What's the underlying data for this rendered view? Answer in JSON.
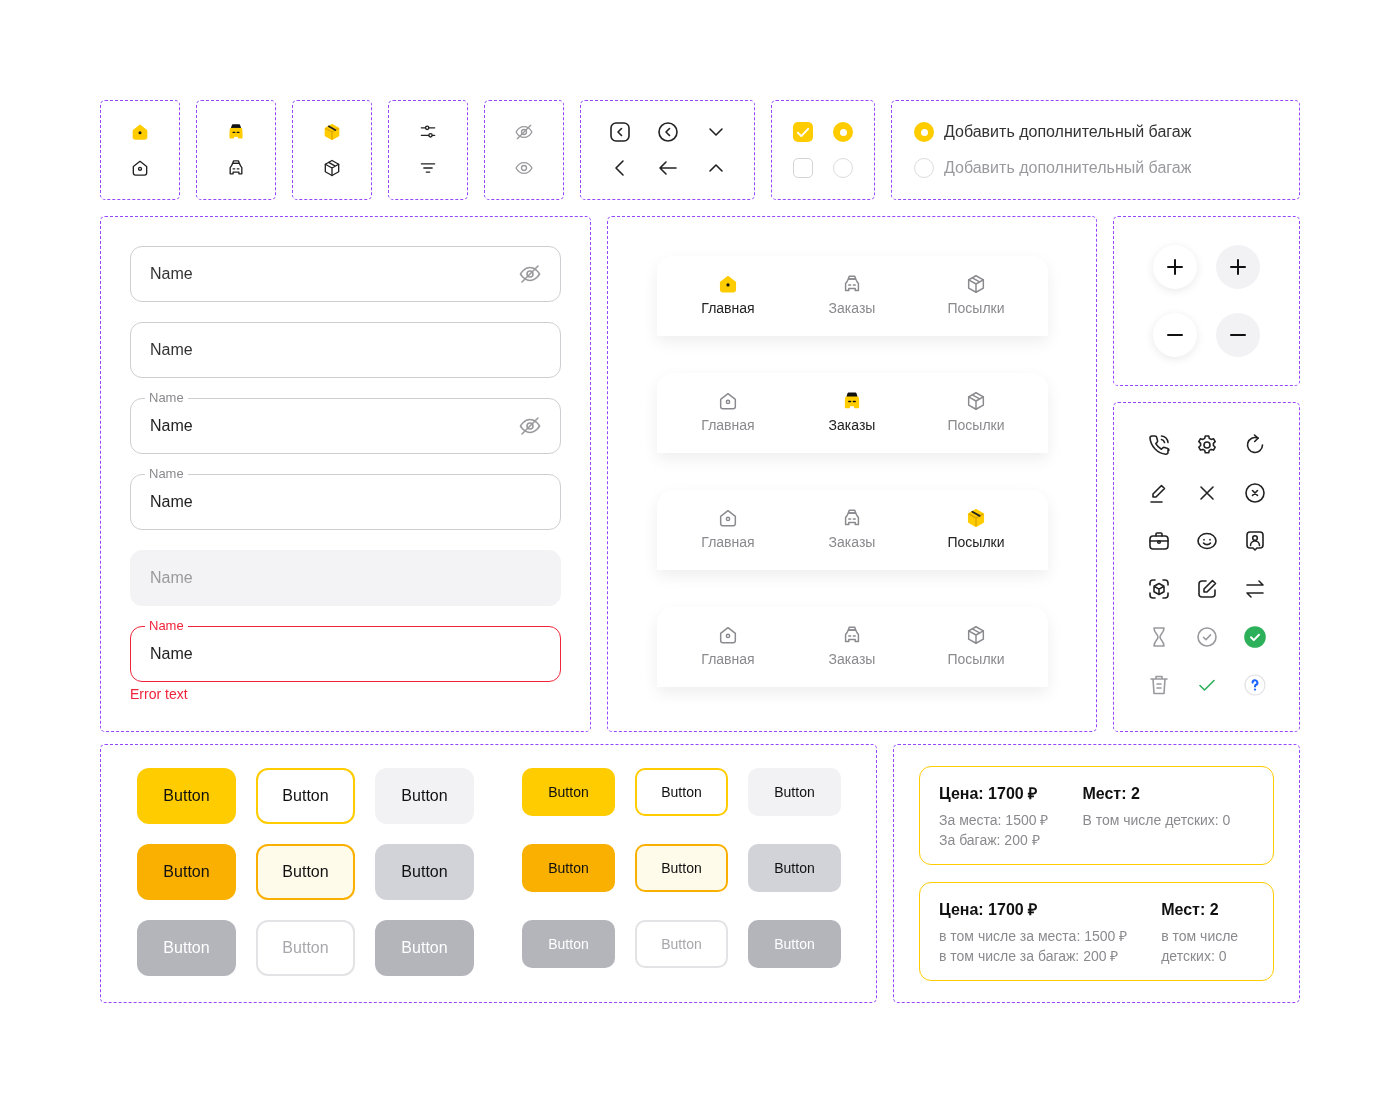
{
  "selection_controls": [
    {
      "kind": "checkbox",
      "checked": true
    },
    {
      "kind": "radio",
      "selected": true
    },
    {
      "kind": "checkbox",
      "checked": false
    },
    {
      "kind": "radio",
      "selected": false
    }
  ],
  "radio_options": [
    {
      "label": "Добавить дополнительный багаж",
      "selected": true
    },
    {
      "label": "Добавить дополнительный багаж",
      "selected": false
    }
  ],
  "fields": [
    {
      "placeholder": "Name",
      "eye_toggle": true,
      "disabled": false,
      "invalid": false
    },
    {
      "placeholder": "Name",
      "eye_toggle": false,
      "disabled": false,
      "invalid": false
    },
    {
      "label": "Name",
      "value": "Name",
      "eye_toggle": true,
      "disabled": false,
      "invalid": false
    },
    {
      "label": "Name",
      "value": "Name",
      "eye_toggle": false,
      "disabled": false,
      "invalid": false
    },
    {
      "placeholder": "Name",
      "eye_toggle": false,
      "disabled": true,
      "invalid": false
    },
    {
      "label": "Name",
      "value": "Name",
      "eye_toggle": false,
      "disabled": false,
      "invalid": true,
      "error_text": "Error text"
    }
  ],
  "tab_bars": [
    {
      "tabs": [
        {
          "kind": "home",
          "label": "Главная",
          "selected": true
        },
        {
          "kind": "car",
          "label": "Заказы",
          "selected": false
        },
        {
          "kind": "box",
          "label": "Посылки",
          "selected": false
        }
      ]
    },
    {
      "tabs": [
        {
          "kind": "home",
          "label": "Главная",
          "selected": false
        },
        {
          "kind": "car",
          "label": "Заказы",
          "selected": true
        },
        {
          "kind": "box",
          "label": "Посылки",
          "selected": false
        }
      ]
    },
    {
      "tabs": [
        {
          "kind": "home",
          "label": "Главная",
          "selected": false
        },
        {
          "kind": "car",
          "label": "Заказы",
          "selected": false
        },
        {
          "kind": "box",
          "label": "Посылки",
          "selected": true
        }
      ]
    },
    {
      "tabs": [
        {
          "kind": "home",
          "label": "Главная",
          "selected": false
        },
        {
          "kind": "car",
          "label": "Заказы",
          "selected": false
        },
        {
          "kind": "box",
          "label": "Посылки",
          "selected": false
        }
      ]
    }
  ],
  "button_sets": [
    {
      "kind": "large",
      "buttons": [
        {
          "label": "Button",
          "kind": "primary",
          "pressed": false,
          "disabled": false
        },
        {
          "label": "Button",
          "kind": "outline",
          "pressed": false,
          "disabled": false
        },
        {
          "label": "Button",
          "kind": "secondary",
          "pressed": false,
          "disabled": false
        },
        {
          "label": "Button",
          "kind": "primary",
          "pressed": true,
          "disabled": false
        },
        {
          "label": "Button",
          "kind": "outline",
          "pressed": true,
          "disabled": false
        },
        {
          "label": "Button",
          "kind": "secondary",
          "pressed": true,
          "disabled": false
        },
        {
          "label": "Button",
          "kind": "primary",
          "pressed": false,
          "disabled": true
        },
        {
          "label": "Button",
          "kind": "outline",
          "pressed": false,
          "disabled": true
        },
        {
          "label": "Button",
          "kind": "secondary",
          "pressed": false,
          "disabled": true
        }
      ]
    },
    {
      "kind": "small",
      "buttons": [
        {
          "label": "Button",
          "kind": "primary",
          "pressed": false,
          "disabled": false
        },
        {
          "label": "Button",
          "kind": "outline",
          "pressed": false,
          "disabled": false
        },
        {
          "label": "Button",
          "kind": "secondary",
          "pressed": false,
          "disabled": false
        },
        {
          "label": "Button",
          "kind": "primary",
          "pressed": true,
          "disabled": false
        },
        {
          "label": "Button",
          "kind": "outline",
          "pressed": true,
          "disabled": false
        },
        {
          "label": "Button",
          "kind": "secondary",
          "pressed": true,
          "disabled": false
        },
        {
          "label": "Button",
          "kind": "primary",
          "pressed": false,
          "disabled": true
        },
        {
          "label": "Button",
          "kind": "outline",
          "pressed": false,
          "disabled": true
        },
        {
          "label": "Button",
          "kind": "secondary",
          "pressed": false,
          "disabled": true
        }
      ]
    }
  ],
  "price_cards": [
    {
      "price_title": "Цена: 1700 ₽",
      "price_lines": [
        "За места: 1500 ₽",
        "За багаж: 200 ₽"
      ],
      "seats_title": "Мест: 2",
      "seats_lines": [
        "В том числе детских: 0"
      ]
    },
    {
      "price_title": "Цена: 1700 ₽",
      "price_lines": [
        "в том числе за места: 1500 ₽",
        "в том числе за багаж: 200 ₽"
      ],
      "seats_title": "Мест: 2",
      "seats_lines": [
        "в том числе детских: 0"
      ]
    }
  ]
}
